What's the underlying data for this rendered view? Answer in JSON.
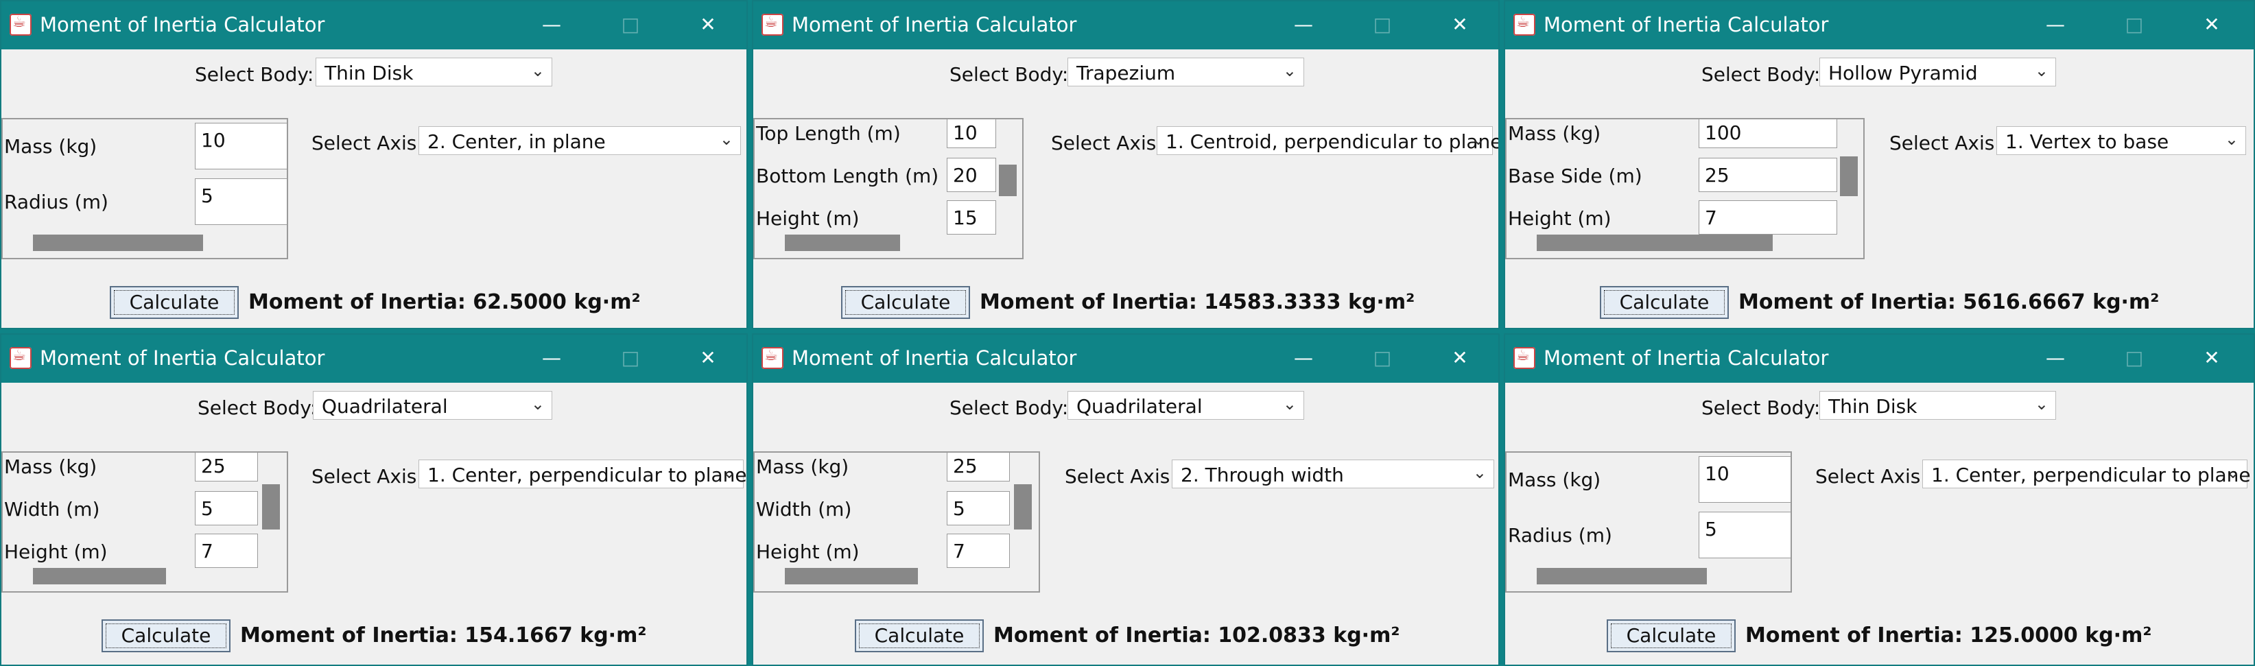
{
  "windows": [
    {
      "title": "Moment of Inertia Calculator",
      "select_body_label": "Select Body:",
      "body": "Thin Disk",
      "select_axis_label": "Select Axis:",
      "axis": "2. Center, in plane",
      "params": [
        {
          "label": "Mass (kg)",
          "value": "10"
        },
        {
          "label": "Radius (m)",
          "value": "5"
        }
      ],
      "calculate_label": "Calculate",
      "result": "Moment of Inertia: 62.5000 kg·m²"
    },
    {
      "title": "Moment of Inertia Calculator",
      "select_body_label": "Select Body:",
      "body": "Trapezium",
      "select_axis_label": "Select Axis:",
      "axis": "1. Centroid, perpendicular to plane",
      "params": [
        {
          "label": "Top Length (m)",
          "value": "10"
        },
        {
          "label": "Bottom Length (m)",
          "value": "20"
        },
        {
          "label": "Height (m)",
          "value": "15"
        }
      ],
      "calculate_label": "Calculate",
      "result": "Moment of Inertia: 14583.3333 kg·m²"
    },
    {
      "title": "Moment of Inertia Calculator",
      "select_body_label": "Select Body:",
      "body": "Hollow Pyramid",
      "select_axis_label": "Select Axis:",
      "axis": "1. Vertex to base",
      "params": [
        {
          "label": "Mass (kg)",
          "value": "100"
        },
        {
          "label": "Base Side (m)",
          "value": "25"
        },
        {
          "label": "Height (m)",
          "value": "7"
        }
      ],
      "calculate_label": "Calculate",
      "result": "Moment of Inertia: 5616.6667 kg·m²"
    },
    {
      "title": "Moment of Inertia Calculator",
      "select_body_label": "Select Body:",
      "body": "Quadrilateral",
      "select_axis_label": "Select Axis:",
      "axis": "1. Center, perpendicular to plane",
      "params": [
        {
          "label": "Mass (kg)",
          "value": "25"
        },
        {
          "label": "Width (m)",
          "value": "5"
        },
        {
          "label": "Height (m)",
          "value": "7"
        }
      ],
      "calculate_label": "Calculate",
      "result": "Moment of Inertia: 154.1667 kg·m²"
    },
    {
      "title": "Moment of Inertia Calculator",
      "select_body_label": "Select Body:",
      "body": "Quadrilateral",
      "select_axis_label": "Select Axis:",
      "axis": "2. Through width",
      "params": [
        {
          "label": "Mass (kg)",
          "value": "25"
        },
        {
          "label": "Width (m)",
          "value": "5"
        },
        {
          "label": "Height (m)",
          "value": "7"
        }
      ],
      "calculate_label": "Calculate",
      "result": "Moment of Inertia: 102.0833 kg·m²"
    },
    {
      "title": "Moment of Inertia Calculator",
      "select_body_label": "Select Body:",
      "body": "Thin Disk",
      "select_axis_label": "Select Axis:",
      "axis": "1. Center, perpendicular to plane",
      "params": [
        {
          "label": "Mass (kg)",
          "value": "10"
        },
        {
          "label": "Radius (m)",
          "value": "5"
        }
      ],
      "calculate_label": "Calculate",
      "result": "Moment of Inertia: 125.0000 kg·m²"
    }
  ],
  "colors": {
    "titlebar": "#0f8487",
    "window_bg": "#f0f0f0",
    "button_bg": "#e5edf5",
    "scroll_thumb": "#888888"
  }
}
